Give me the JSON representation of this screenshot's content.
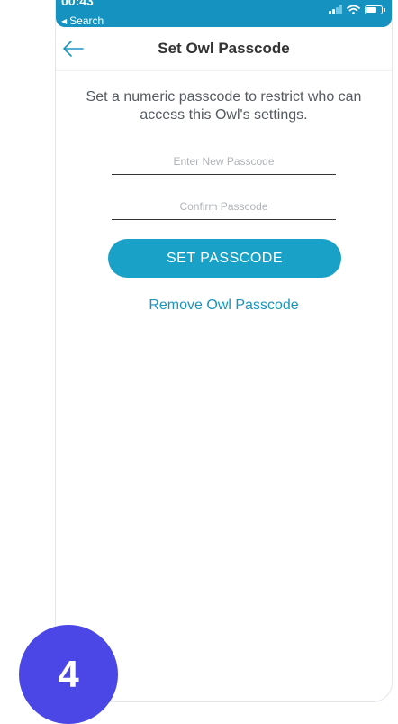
{
  "status_bar": {
    "time": "00:43",
    "back_label": "Search",
    "icons": [
      "signal-icon",
      "wifi-icon",
      "battery-icon"
    ]
  },
  "nav": {
    "back_icon": "arrow-left-icon",
    "title": "Set Owl Passcode"
  },
  "main": {
    "description": "Set a numeric passcode to restrict who can access this Owl's settings.",
    "new_passcode": {
      "value": "",
      "placeholder": "Enter New Passcode"
    },
    "confirm_passcode": {
      "value": "",
      "placeholder": "Confirm Passcode"
    },
    "set_button": "SET PASSCODE",
    "remove_link": "Remove Owl Passcode"
  },
  "step_badge": "4",
  "colors": {
    "accent": "#19a1c7",
    "status_bar": "#1592bf",
    "link": "#1a95bf",
    "badge": "#4a47e6"
  }
}
